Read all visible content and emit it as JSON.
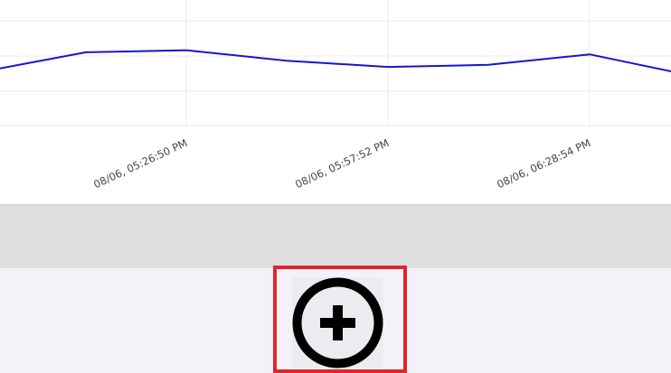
{
  "chart_data": {
    "type": "line",
    "x_labels_visible": [
      "08/06, 05:26:50 PM",
      "08/06, 05:57:52 PM",
      "08/06, 06:28:54 PM"
    ],
    "series": [
      {
        "color": "#1515d0",
        "values": [
          71,
          80,
          81,
          76,
          73,
          74,
          79,
          69
        ]
      }
    ],
    "y_range": [
      45,
      105
    ],
    "grid": true
  },
  "add_button": {
    "icon": "plus-circle-icon",
    "highlighted": true,
    "highlight_color": "#e0262c"
  }
}
